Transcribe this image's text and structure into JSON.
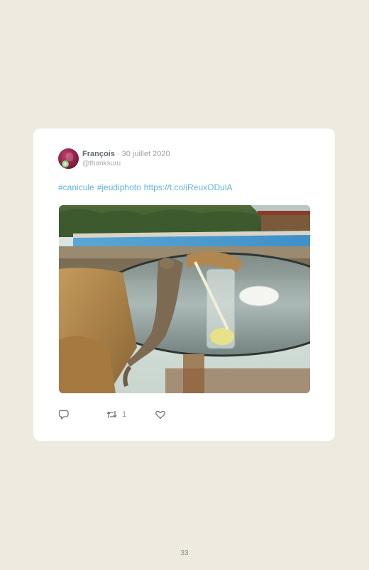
{
  "tweet": {
    "author_name": "François",
    "separator": " · ",
    "date": "30 juillet 2020",
    "handle": "@thanksuru",
    "hashtags": [
      "#canicule",
      "#jeudiphoto"
    ],
    "link": "https://t.co/iReuxODulA",
    "image_description_icon": "photo-squirrel-drinking",
    "actions": {
      "reply_icon": "reply-icon",
      "retweet_icon": "retweet-icon",
      "retweet_count": "1",
      "like_icon": "heart-icon"
    }
  },
  "colors": {
    "page_background": "#eeeae0",
    "card_background": "#ffffff",
    "link": "#5fb3e0",
    "name": "#5f6b73",
    "muted": "#a5abb0"
  },
  "page": {
    "number": "33"
  }
}
